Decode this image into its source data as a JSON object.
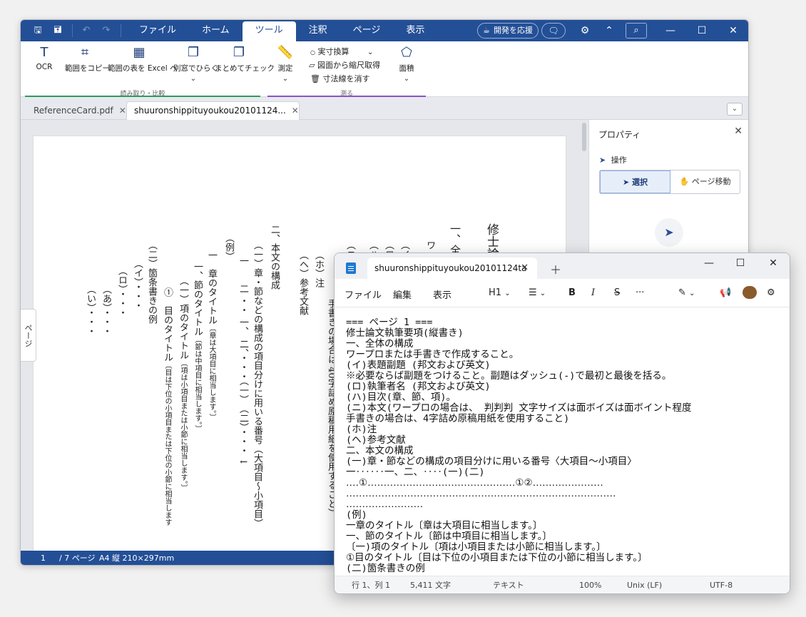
{
  "pdf": {
    "menu_tabs": [
      "ファイル",
      "ホーム",
      "ツール",
      "注釈",
      "ページ",
      "表示"
    ],
    "active_tab": "ツール",
    "support_label": "開発を応援",
    "ribbon": {
      "ocr": "OCR",
      "copy_range": "範囲をコピー",
      "table_excel": "範囲の表を Excel へ",
      "open_separate": "別窓でひらく",
      "batch_check": "まとめてチェック",
      "measure": "測定",
      "actual_size": "実寸換算",
      "scale_from_drawing": "図面から縮尺取得",
      "clear_dims": "寸法線を消す",
      "area": "面積",
      "group_read": "読み取り・比較",
      "group_measure": "測る"
    },
    "doc_tabs": [
      {
        "label": "ReferenceCard.pdf"
      },
      {
        "label": "shuuronshippituyoukou20101124..."
      }
    ],
    "side_tab": "ページ",
    "page_text": {
      "c1": "修士論",
      "c2": "一、全",
      "c3": "ワ",
      "c4": "（イ",
      "c5": "（ロ",
      "c6": "（ハ",
      "c7": "（ニ",
      "c8": "手書きの場合は 40字詰め原稿用紙を使用すること）",
      "c9": "（ホ）注",
      "c10": "（ヘ）参考文献",
      "c11": "二、本文の構成",
      "c12": "（一）章・節などの構成の項目分けに用いる番号（大項目～小項目）",
      "c13": "一　　二 ・・ 一、 二、・・・（一）　（二）・・・ ↓",
      "c14": "（例）",
      "c15": "一　章のタイトル",
      "c15s": "〔章は大項目に相当します。〕",
      "c16": "一、節のタイトル",
      "c16s": "〔節は中項目に相当します。〕",
      "c17": "（一）項のタイトル",
      "c17s": "〔項は小項目または小節に相当します。〕",
      "c18": "①　目のタイトル",
      "c18s": "〔目は下位の小項目または下位の小節に相当します",
      "c19": "（二）箇条書きの例",
      "c20": "（イ）・・・",
      "c21": "（ロ）・・・",
      "c22": "（あ）・・・",
      "c23": "（い）・・・"
    },
    "props": {
      "title": "プロパティ",
      "section": "操作",
      "select": "選択",
      "page_move": "ページ移動"
    },
    "status": {
      "page": "1",
      "total": "/ 7 ページ",
      "size": "A4 縦 210×297mm"
    }
  },
  "notepad": {
    "tab_title": "shuuronshippituyoukou20101124ta",
    "menu": [
      "ファイル",
      "編集",
      "表示"
    ],
    "heading": "H1",
    "text": "=== ページ 1 ===\n修士論文執筆要項(縦書き)\n一、全体の構成\nワープロまたは手書きで作成すること。\n(イ)表題副題 (邦文および英文)\n※必要ならば副題をつけること。副題はダッシュ(-)で最初と最後を括る。\n(ロ)執筆者名 (邦文および英文)\n(ハ)目次(章、節、項)。\n(ニ)本文(ワープロの場合は、 判判判 文字サイズは面ボイズは面ボイント程度\n手書きの場合は、4字詰め原稿用紙を使用すること)\n(ホ)注\n(ヘ)参考文献\n二、本文の構成\n(一)章・節などの構成の項目分けに用いる番号〈大項目～小項目〉\n一‥‥‥一、二、‥‥(一)(二)\n‥‥①‥‥‥‥‥‥‥‥‥‥‥‥‥‥‥‥‥‥‥‥‥‥‥①②‥‥‥‥‥‥‥‥‥‥‥\n‥‥‥‥‥‥‥‥‥‥‥‥‥‥‥‥‥‥‥‥‥‥‥‥‥‥‥‥‥‥‥‥‥‥‥‥‥‥‥‥‥‥\n‥‥‥‥‥‥‥‥‥‥‥‥\n(例)\n一章のタイトル〔章は大項目に相当します。〕\n一、節のタイトル〔節は中項目に相当します。〕\n〔一)項のタイトル〔項は小項目または小節に相当します。〕\n①目のタイトル〔目は下位の小項目または下位の小節に相当します。〕\n(二)箇条書きの例",
    "status": {
      "position": "行 1、列 1",
      "chars": "5,411 文字",
      "mode": "テキスト",
      "zoom": "100%",
      "eol": "Unix (LF)",
      "encoding": "UTF-8"
    }
  }
}
